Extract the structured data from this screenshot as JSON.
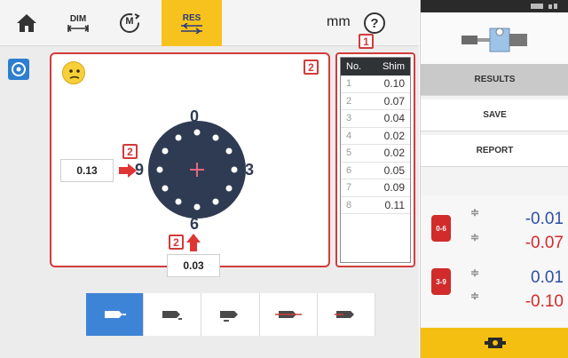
{
  "toolbar": {
    "dim_label": "DIM",
    "measure_label": "M",
    "res_label": "RES",
    "unit": "mm",
    "help_symbol": "?"
  },
  "callouts": {
    "table": "1",
    "panel": "2",
    "left_arrow": "2",
    "bottom_arrow": "2"
  },
  "diagram": {
    "top": "0",
    "right": "3",
    "bottom": "6",
    "left": "9",
    "left_value": "0.13",
    "bottom_value": "0.03"
  },
  "shim_table": {
    "col_no": "No.",
    "col_shim": "Shim",
    "rows": [
      {
        "no": "1",
        "shim": "0.10"
      },
      {
        "no": "2",
        "shim": "0.07"
      },
      {
        "no": "3",
        "shim": "0.04"
      },
      {
        "no": "4",
        "shim": "0.02"
      },
      {
        "no": "5",
        "shim": "0.02"
      },
      {
        "no": "6",
        "shim": "0.05"
      },
      {
        "no": "7",
        "shim": "0.09"
      },
      {
        "no": "8",
        "shim": "0.11"
      }
    ]
  },
  "device": {
    "menu": {
      "results": "RESULTS",
      "save": "SAVE",
      "report": "REPORT"
    },
    "results": [
      {
        "badge": "0-6",
        "top": "-0.01",
        "bottom": "-0.07"
      },
      {
        "badge": "3-9",
        "top": "0.01",
        "bottom": "-0.10"
      }
    ]
  },
  "colors": {
    "accent_yellow": "#f7c21d",
    "callout_red": "#d23b3b",
    "active_blue": "#3e84d6",
    "value_blue": "#2f4fa8",
    "value_red": "#d42a2a",
    "disc_navy": "#2f3b52"
  },
  "icons": [
    "home-icon",
    "dimensions-icon",
    "measure-icon",
    "results-icon",
    "help-icon",
    "settings-icon",
    "neutral-face-icon",
    "shim-bolt-icon",
    "machine-thumbnail-icon",
    "results-badge-icon",
    "machine-icon"
  ]
}
